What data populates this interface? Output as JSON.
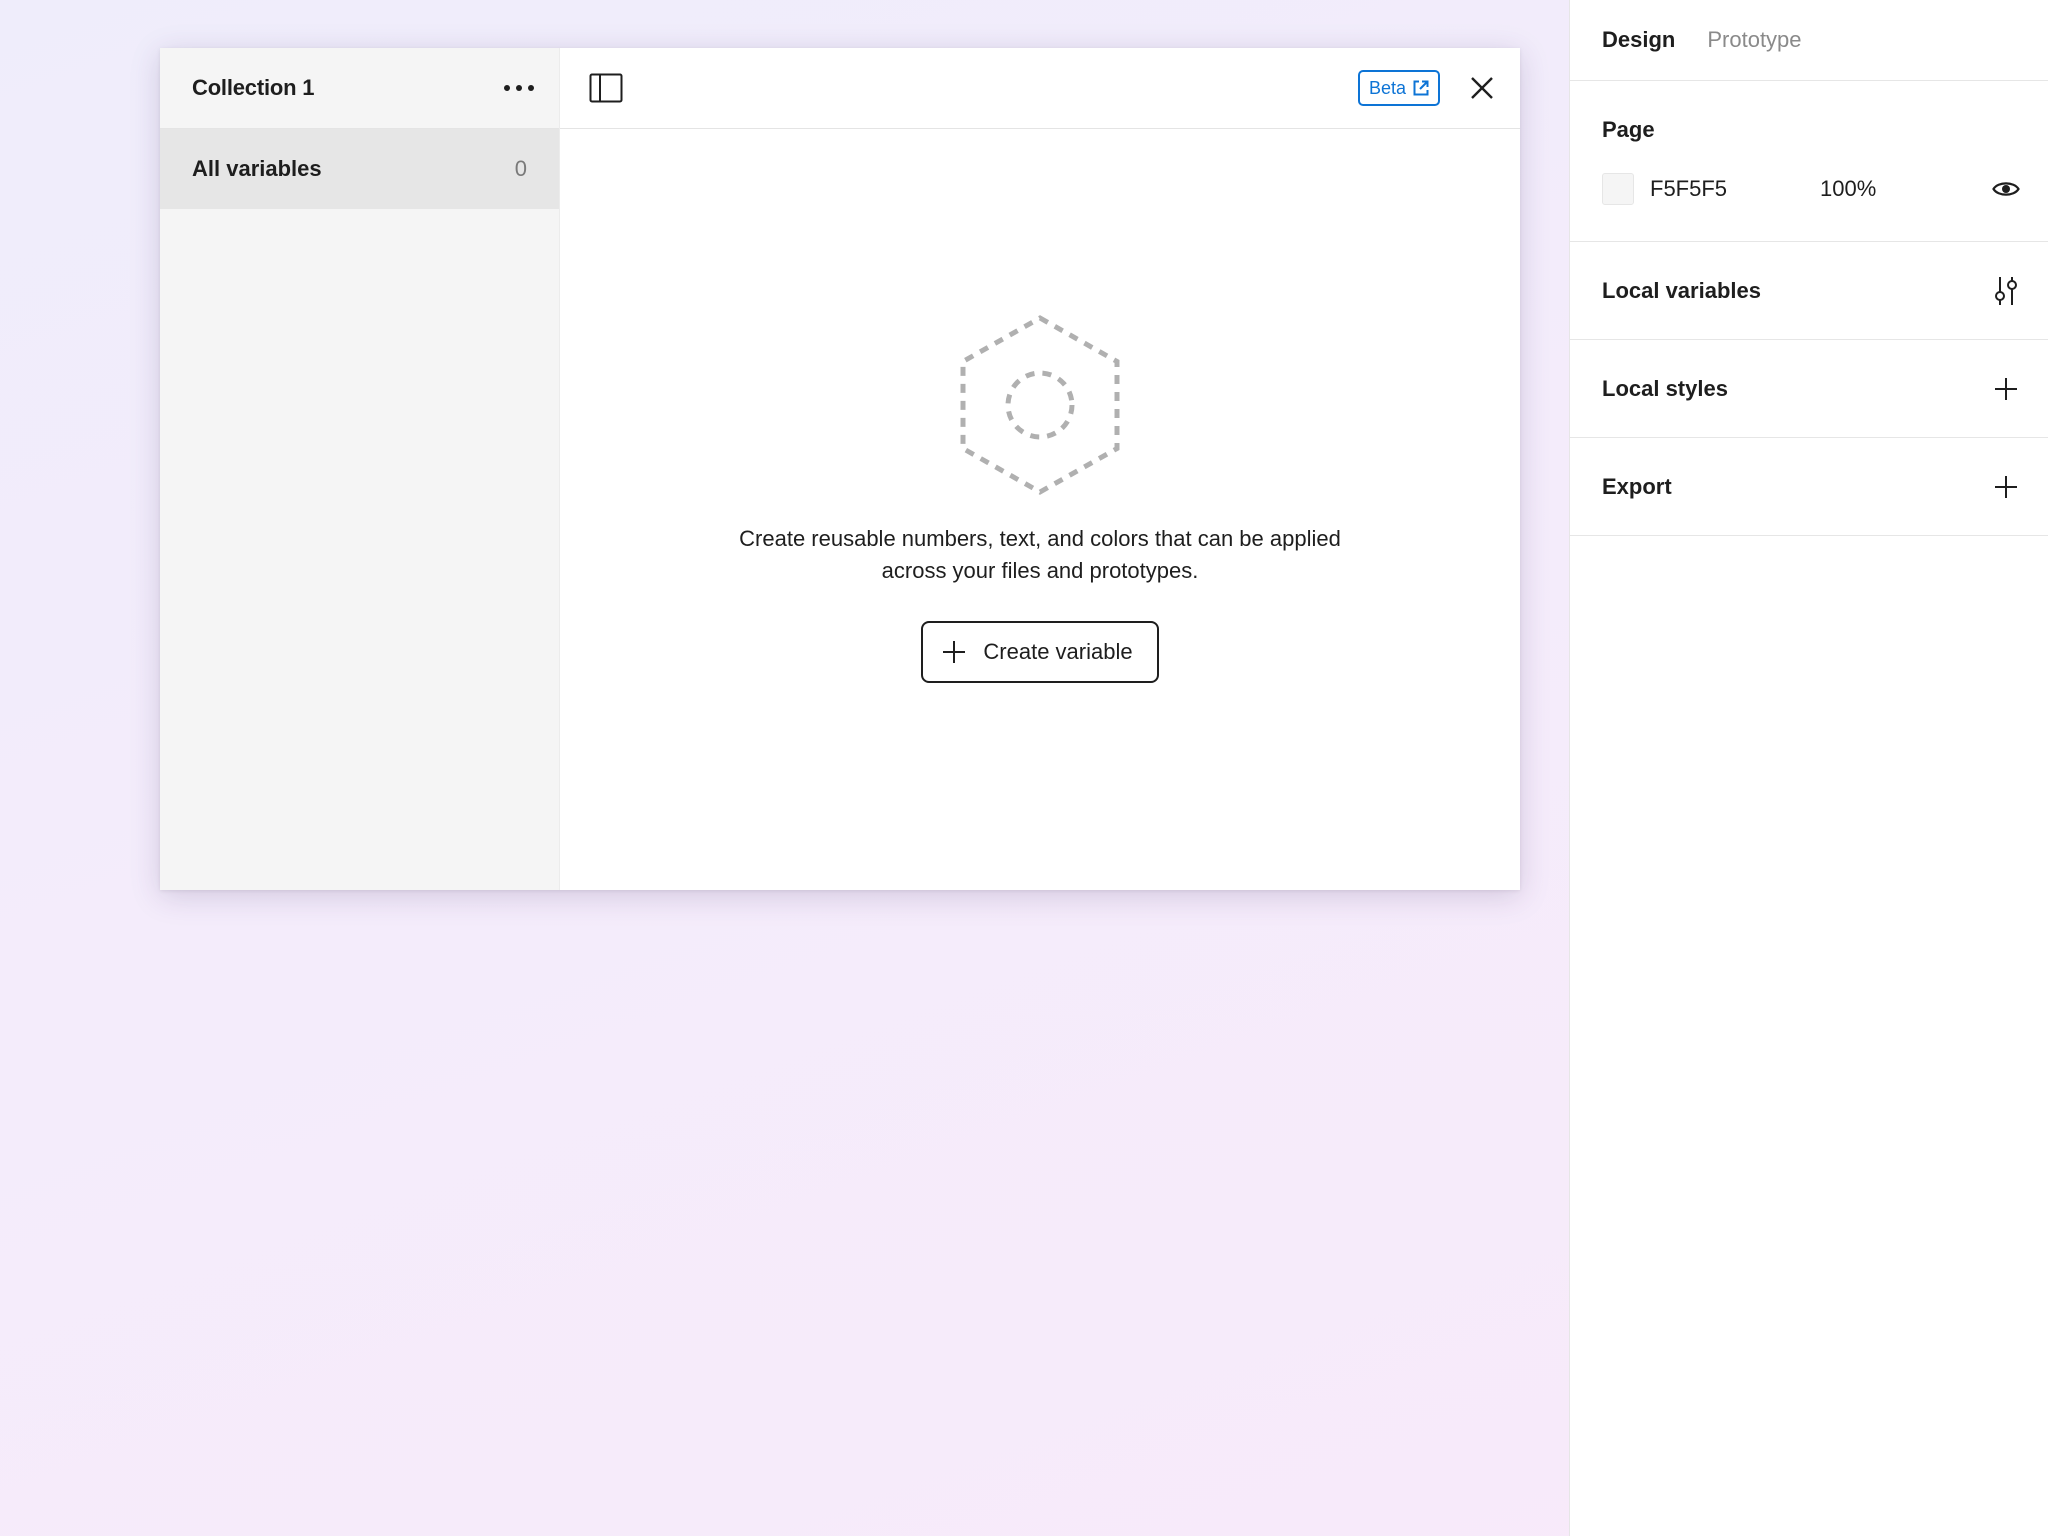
{
  "modal": {
    "sidebar": {
      "collection_title": "Collection 1",
      "all_variables_label": "All variables",
      "all_variables_count": "0"
    },
    "header": {
      "beta_label": "Beta"
    },
    "empty_state": {
      "message": "Create reusable numbers, text, and colors that can be applied across your files and prototypes.",
      "create_button_label": "Create variable"
    }
  },
  "right_panel": {
    "tabs": [
      {
        "label": "Design",
        "active": true
      },
      {
        "label": "Prototype",
        "active": false
      }
    ],
    "page": {
      "title": "Page",
      "color_hex": "F5F5F5",
      "opacity": "100%"
    },
    "local_variables": {
      "title": "Local variables"
    },
    "local_styles": {
      "title": "Local styles"
    },
    "export": {
      "title": "Export"
    }
  },
  "colors": {
    "accent_blue": "#0d74d6",
    "page_swatch": "#F5F5F5"
  },
  "icons": {
    "more": "ellipsis-icon",
    "panel_toggle": "sidebar-toggle-icon",
    "external_link": "external-link-icon",
    "close": "close-icon",
    "empty_state": "dashed-hexagon-icon",
    "plus": "plus-icon",
    "eye": "eye-icon",
    "adjust": "sliders-icon"
  }
}
